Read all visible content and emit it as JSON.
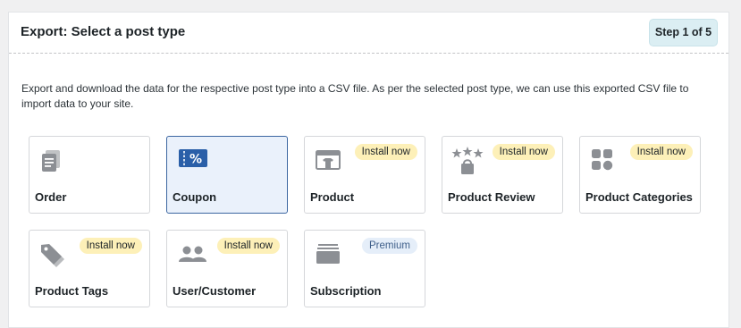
{
  "header": {
    "title": "Export: Select a post type",
    "step": "Step 1 of 5"
  },
  "description": "Export and download the data for the respective post type into a CSV file. As per the selected post type, we can use this exported CSV file to import data to your site.",
  "cards": [
    {
      "label": "Order",
      "icon": "order-icon",
      "badge": null,
      "selected": false
    },
    {
      "label": "Coupon",
      "icon": "coupon-icon",
      "badge": null,
      "selected": true
    },
    {
      "label": "Product",
      "icon": "product-icon",
      "badge": "Install now",
      "selected": false
    },
    {
      "label": "Product Review",
      "icon": "product-review-icon",
      "badge": "Install now",
      "selected": false
    },
    {
      "label": "Product Categories",
      "icon": "product-categories-icon",
      "badge": "Install now",
      "selected": false
    },
    {
      "label": "Product Tags",
      "icon": "product-tags-icon",
      "badge": "Install now",
      "selected": false
    },
    {
      "label": "User/Customer",
      "icon": "user-customer-icon",
      "badge": "Install now",
      "selected": false
    },
    {
      "label": "Subscription",
      "icon": "subscription-icon",
      "badge": "Premium",
      "selected": false
    }
  ],
  "colors": {
    "icon_gray": "#8c8f94",
    "coupon_blue": "#2a5fa8",
    "selected_bg": "#eaf1fb",
    "selected_border": "#3c66a1",
    "install_badge_bg": "#fdf0b8",
    "premium_badge_bg": "#e5eef9"
  }
}
